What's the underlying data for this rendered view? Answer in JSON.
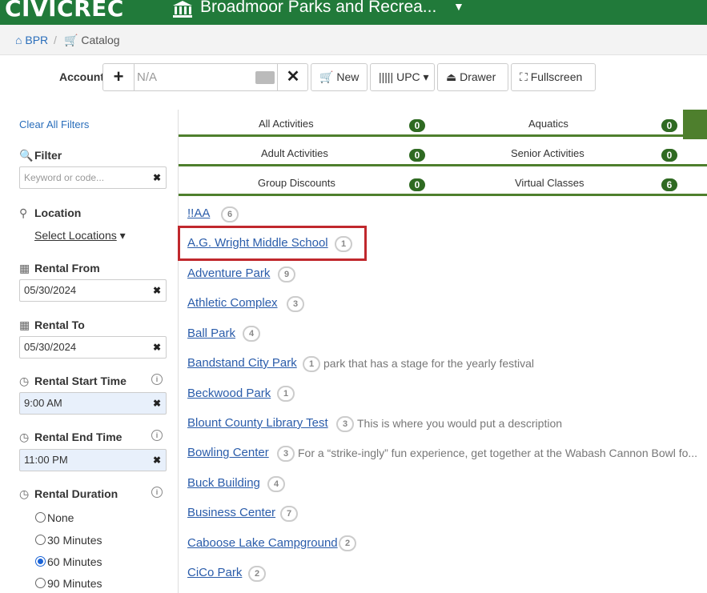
{
  "topbar": {
    "logo": "CIVICREC",
    "org_title": "Broadmoor Parks and Recrea...",
    "caret": "▼",
    "colors": {
      "bar": "#217a3a",
      "accent": "#4e7f2d"
    },
    "org_icon": "building-icon"
  },
  "breadcrumb": {
    "home": "BPR",
    "separator": "/",
    "catalog": "Catalog"
  },
  "account": {
    "label": "Account",
    "add": "+",
    "value": "N/A",
    "clear": "✕",
    "new_label": "New",
    "upc_label": "UPC",
    "drawer_label": "Drawer",
    "fullscreen_label": "Fullscreen"
  },
  "sidebar": {
    "clear_filters": "Clear All Filters",
    "filter_label": "Filter",
    "filter_placeholder": "Keyword or code...",
    "location_label": "Location",
    "select_locations": "Select Locations",
    "rental_from_label": "Rental From",
    "rental_from_value": "05/30/2024",
    "rental_to_label": "Rental To",
    "rental_to_value": "05/30/2024",
    "start_time_label": "Rental Start Time",
    "start_time_value": "9:00 AM",
    "end_time_label": "Rental End Time",
    "end_time_value": "11:00 PM",
    "duration_label": "Rental Duration",
    "durations": [
      {
        "label": "None",
        "selected": false
      },
      {
        "label": "30 Minutes",
        "selected": false
      },
      {
        "label": "60 Minutes",
        "selected": true
      },
      {
        "label": "90 Minutes",
        "selected": false
      }
    ]
  },
  "categories": [
    {
      "label": "All Activities",
      "count": "0"
    },
    {
      "label": "Aquatics",
      "count": "0"
    },
    {
      "label": "Adult Activities",
      "count": "0"
    },
    {
      "label": "Senior Activities",
      "count": "0"
    },
    {
      "label": "Group Discounts",
      "count": "0"
    },
    {
      "label": "Virtual Classes",
      "count": "6"
    }
  ],
  "locations": [
    {
      "name": "!!AA",
      "count": "6",
      "desc": ""
    },
    {
      "name": "A.G. Wright Middle School",
      "count": "1",
      "desc": "",
      "highlighted": true
    },
    {
      "name": "Adventure Park",
      "count": "9",
      "desc": ""
    },
    {
      "name": "Athletic Complex",
      "count": "3",
      "desc": ""
    },
    {
      "name": "Ball Park",
      "count": "4",
      "desc": ""
    },
    {
      "name": "Bandstand City Park",
      "count": "1",
      "desc": "park that has a stage for the yearly festival"
    },
    {
      "name": "Beckwood Park",
      "count": "1",
      "desc": ""
    },
    {
      "name": "Blount County Library Test",
      "count": "3",
      "desc": "This is where you would put a description"
    },
    {
      "name": "Bowling Center",
      "count": "3",
      "desc": "For a “strike-ingly” fun experience, get together at the Wabash Cannon Bowl fo..."
    },
    {
      "name": "Buck Building",
      "count": "4",
      "desc": ""
    },
    {
      "name": "Business Center",
      "count": "7",
      "desc": ""
    },
    {
      "name": "Caboose Lake Campground",
      "count": "2",
      "desc": ""
    },
    {
      "name": "CiCo Park",
      "count": "2",
      "desc": ""
    }
  ]
}
